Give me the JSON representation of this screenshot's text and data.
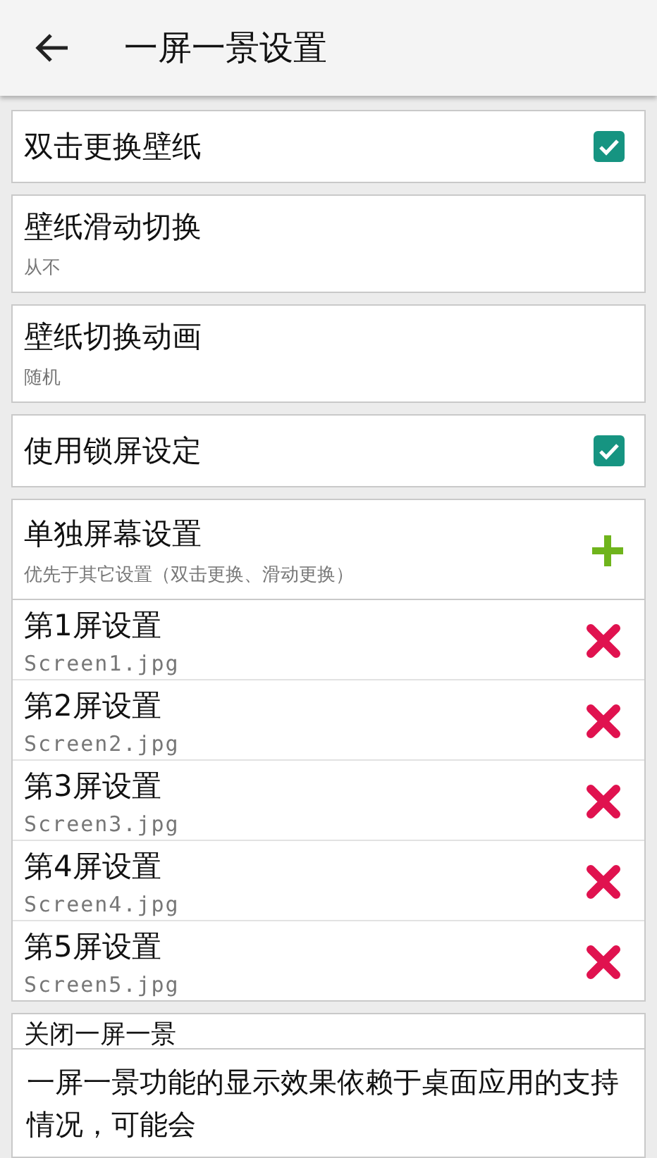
{
  "header": {
    "title": "一屏一景设置"
  },
  "settings": [
    {
      "kind": "checkbox",
      "title": "双击更换壁纸",
      "checked": true
    },
    {
      "kind": "value",
      "title": "壁纸滑动切换",
      "value": "从不"
    },
    {
      "kind": "value",
      "title": "壁纸切换动画",
      "value": "随机"
    },
    {
      "kind": "checkbox",
      "title": "使用锁屏设定",
      "checked": true
    }
  ],
  "screens_section": {
    "title": "单独屏幕设置",
    "subtitle": "优先于其它设置（双击更换、滑动更换）",
    "screens": [
      {
        "title": "第1屏设置",
        "file": "Screen1.jpg"
      },
      {
        "title": "第2屏设置",
        "file": "Screen2.jpg"
      },
      {
        "title": "第3屏设置",
        "file": "Screen3.jpg"
      },
      {
        "title": "第4屏设置",
        "file": "Screen4.jpg"
      },
      {
        "title": "第5屏设置",
        "file": "Screen5.jpg"
      }
    ]
  },
  "disable_row": {
    "title": "关闭一屏一景"
  },
  "toast": {
    "text": "一屏一景功能的显示效果依赖于桌面应用的支持情况，可能会"
  }
}
